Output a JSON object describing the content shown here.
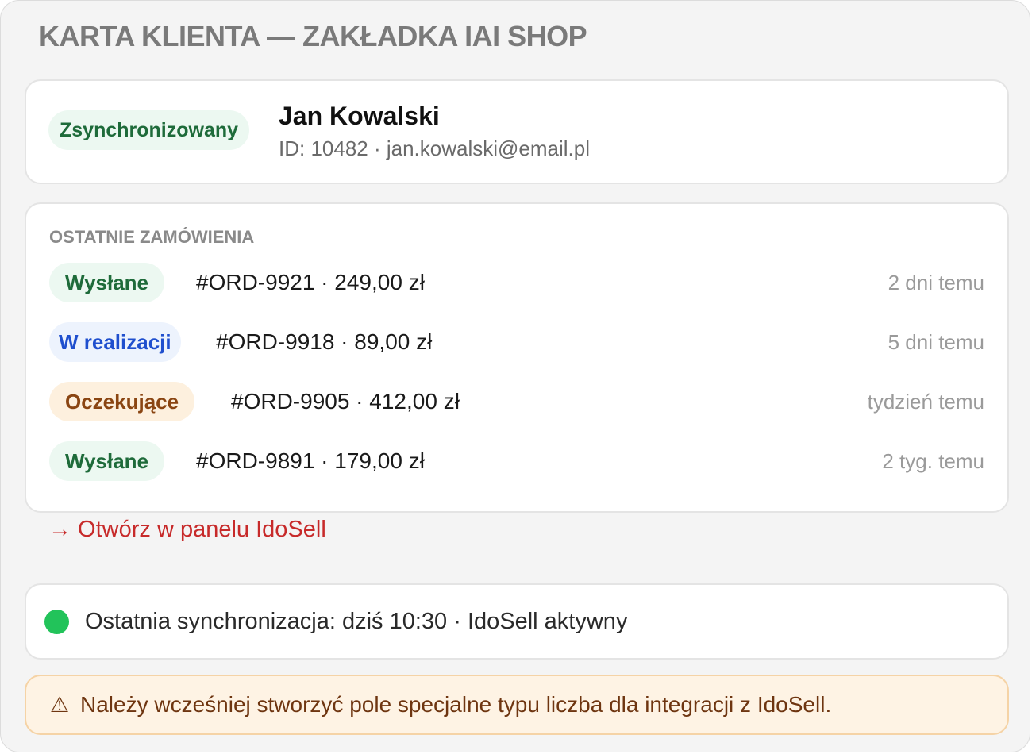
{
  "page": {
    "title": "KARTA KLIENTA — ZAKŁADKA IAI SHOP"
  },
  "customer": {
    "sync_badge": "Zsynchronizowany",
    "name": "Jan Kowalski",
    "meta": "ID: 10482 · jan.kowalski@email.pl"
  },
  "orders": {
    "section_label": "OSTATNIE ZAMÓWIENIA",
    "items": [
      {
        "status": "Wysłane",
        "status_color": "green",
        "text": "#ORD-9921 · 249,00 zł",
        "time": "2 dni temu"
      },
      {
        "status": "W realizacji",
        "status_color": "blue",
        "text": "#ORD-9918 · 89,00 zł",
        "time": "5 dni temu"
      },
      {
        "status": "Oczekujące",
        "status_color": "orange",
        "text": "#ORD-9905 · 412,00 zł",
        "time": "tydzień temu"
      },
      {
        "status": "Wysłane",
        "status_color": "green",
        "text": "#ORD-9891 · 179,00 zł",
        "time": "2 tyg. temu"
      }
    ]
  },
  "link": {
    "label": "→ Otwórz w panelu IdoSell"
  },
  "sync": {
    "status_icon": "green-dot-icon",
    "status_color": "#22c35a",
    "text": "Ostatnia synchronizacja: dziś 10:30 · IdoSell aktywny"
  },
  "warning": {
    "icon": "warning-icon",
    "text": "Należy wcześniej stworzyć pole specjalne typu liczba dla integracji z IdoSell."
  }
}
